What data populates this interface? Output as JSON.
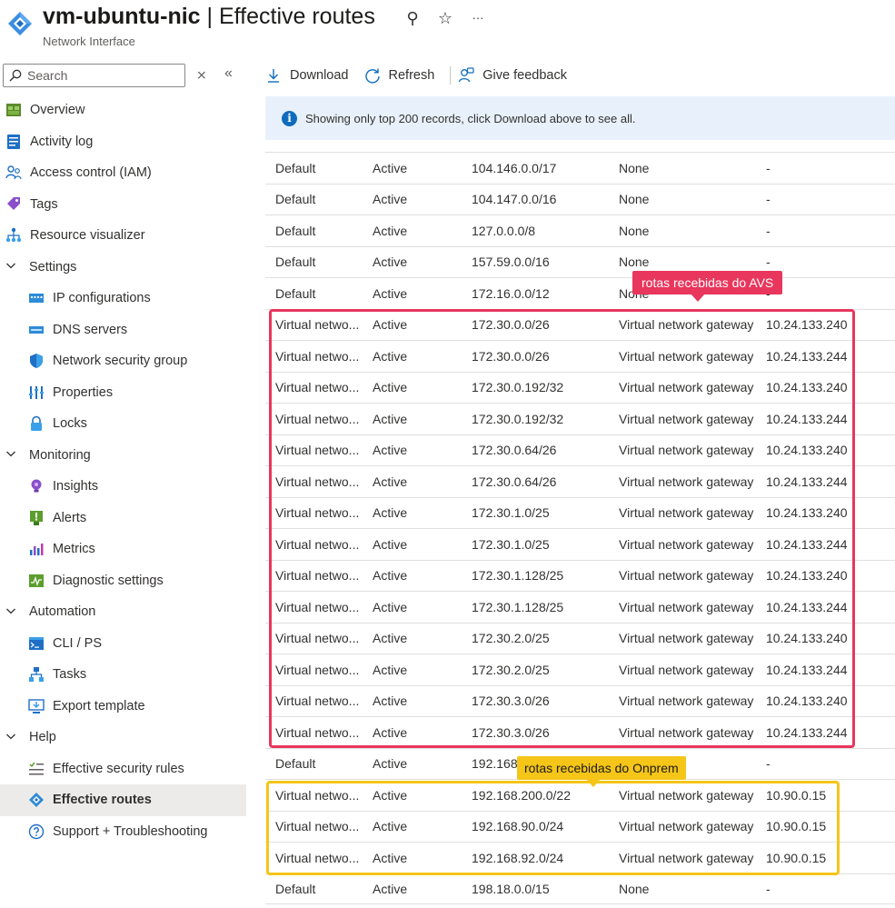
{
  "header": {
    "title_resource": "vm-ubuntu-nic",
    "title_sep": " | ",
    "title_page": "Effective routes",
    "subtitle": "Network Interface",
    "icons": [
      "pin-icon",
      "star-icon",
      "more-icon"
    ],
    "pin_glyph": "⚲",
    "star_glyph": "☆",
    "more_glyph": "···"
  },
  "sidebar": {
    "search_placeholder": "Search",
    "collapse_all_glyph": "⨯",
    "collapse_pane_glyph": "«",
    "top_items": [
      {
        "label": "Overview",
        "icon": "overview-icon"
      },
      {
        "label": "Activity log",
        "icon": "activity-log-icon"
      },
      {
        "label": "Access control (IAM)",
        "icon": "iam-icon"
      },
      {
        "label": "Tags",
        "icon": "tag-icon"
      },
      {
        "label": "Resource visualizer",
        "icon": "visualizer-icon"
      }
    ],
    "groups": [
      {
        "label": "Settings",
        "items": [
          {
            "label": "IP configurations",
            "icon": "ip-config-icon"
          },
          {
            "label": "DNS servers",
            "icon": "dns-icon"
          },
          {
            "label": "Network security group",
            "icon": "nsg-shield-icon"
          },
          {
            "label": "Properties",
            "icon": "properties-icon"
          },
          {
            "label": "Locks",
            "icon": "lock-icon"
          }
        ]
      },
      {
        "label": "Monitoring",
        "items": [
          {
            "label": "Insights",
            "icon": "insights-icon"
          },
          {
            "label": "Alerts",
            "icon": "alerts-icon"
          },
          {
            "label": "Metrics",
            "icon": "metrics-icon"
          },
          {
            "label": "Diagnostic settings",
            "icon": "diagnostic-icon"
          }
        ]
      },
      {
        "label": "Automation",
        "items": [
          {
            "label": "CLI / PS",
            "icon": "cli-icon"
          },
          {
            "label": "Tasks",
            "icon": "tasks-icon"
          },
          {
            "label": "Export template",
            "icon": "export-icon"
          }
        ]
      },
      {
        "label": "Help",
        "items": [
          {
            "label": "Effective security rules",
            "icon": "security-rules-icon"
          },
          {
            "label": "Effective routes",
            "icon": "routes-icon",
            "active": true
          },
          {
            "label": "Support + Troubleshooting",
            "icon": "support-icon"
          }
        ]
      }
    ]
  },
  "toolbar": {
    "download_label": "Download",
    "refresh_label": "Refresh",
    "feedback_label": "Give feedback"
  },
  "banner": {
    "text": "Showing only top 200 records, click Download above to see all."
  },
  "routes": [
    [
      "Default",
      "Active",
      "104.146.0.0/17",
      "None",
      "-"
    ],
    [
      "Default",
      "Active",
      "104.147.0.0/16",
      "None",
      "-"
    ],
    [
      "Default",
      "Active",
      "127.0.0.0/8",
      "None",
      "-"
    ],
    [
      "Default",
      "Active",
      "157.59.0.0/16",
      "None",
      "-"
    ],
    [
      "Default",
      "Active",
      "172.16.0.0/12",
      "None",
      "-"
    ],
    [
      "Virtual netwo...",
      "Active",
      "172.30.0.0/26",
      "Virtual network gateway",
      "10.24.133.240"
    ],
    [
      "Virtual netwo...",
      "Active",
      "172.30.0.0/26",
      "Virtual network gateway",
      "10.24.133.244"
    ],
    [
      "Virtual netwo...",
      "Active",
      "172.30.0.192/32",
      "Virtual network gateway",
      "10.24.133.240"
    ],
    [
      "Virtual netwo...",
      "Active",
      "172.30.0.192/32",
      "Virtual network gateway",
      "10.24.133.244"
    ],
    [
      "Virtual netwo...",
      "Active",
      "172.30.0.64/26",
      "Virtual network gateway",
      "10.24.133.240"
    ],
    [
      "Virtual netwo...",
      "Active",
      "172.30.0.64/26",
      "Virtual network gateway",
      "10.24.133.244"
    ],
    [
      "Virtual netwo...",
      "Active",
      "172.30.1.0/25",
      "Virtual network gateway",
      "10.24.133.240"
    ],
    [
      "Virtual netwo...",
      "Active",
      "172.30.1.0/25",
      "Virtual network gateway",
      "10.24.133.244"
    ],
    [
      "Virtual netwo...",
      "Active",
      "172.30.1.128/25",
      "Virtual network gateway",
      "10.24.133.240"
    ],
    [
      "Virtual netwo...",
      "Active",
      "172.30.1.128/25",
      "Virtual network gateway",
      "10.24.133.244"
    ],
    [
      "Virtual netwo...",
      "Active",
      "172.30.2.0/25",
      "Virtual network gateway",
      "10.24.133.240"
    ],
    [
      "Virtual netwo...",
      "Active",
      "172.30.2.0/25",
      "Virtual network gateway",
      "10.24.133.244"
    ],
    [
      "Virtual netwo...",
      "Active",
      "172.30.3.0/26",
      "Virtual network gateway",
      "10.24.133.240"
    ],
    [
      "Virtual netwo...",
      "Active",
      "172.30.3.0/26",
      "Virtual network gateway",
      "10.24.133.244"
    ],
    [
      "Default",
      "Active",
      "192.168.",
      "",
      "-"
    ],
    [
      "Virtual netwo...",
      "Active",
      "192.168.200.0/22",
      "Virtual network gateway",
      "10.90.0.15"
    ],
    [
      "Virtual netwo...",
      "Active",
      "192.168.90.0/24",
      "Virtual network gateway",
      "10.90.0.15"
    ],
    [
      "Virtual netwo...",
      "Active",
      "192.168.92.0/24",
      "Virtual network gateway",
      "10.90.0.15"
    ],
    [
      "Default",
      "Active",
      "198.18.0.0/15",
      "None",
      "-"
    ]
  ],
  "annotations": {
    "avs_label": "rotas recebidas do AVS",
    "onprem_label": "rotas recebidas do Onprem",
    "avs_color": "#e8365d",
    "onprem_color": "#f5c518"
  }
}
